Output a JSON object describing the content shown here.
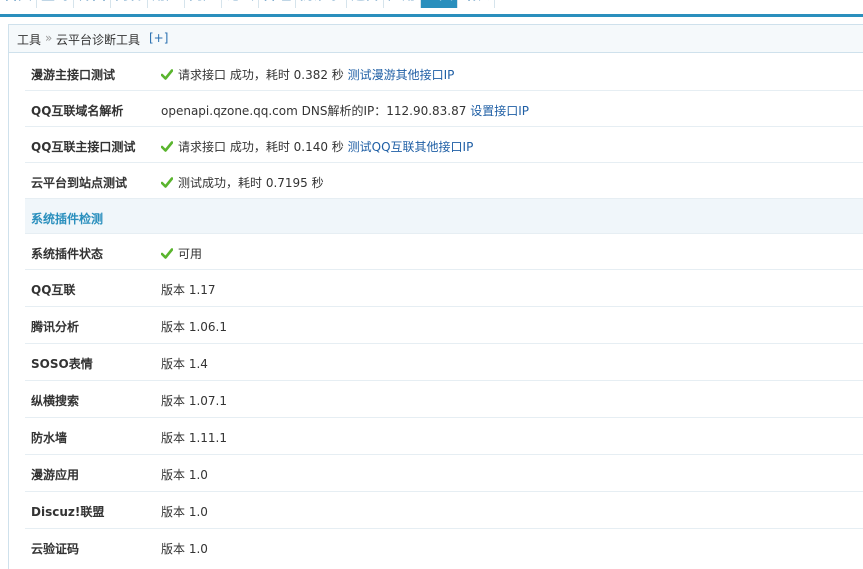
{
  "nav": {
    "items": [
      "首页",
      "全局",
      "界面",
      "内容",
      "用户",
      "门户",
      "论坛",
      "群组",
      "防灌水",
      "运营",
      "应用",
      "工具",
      "站长",
      "UCenter"
    ],
    "active_index": 11
  },
  "breadcrumb": {
    "root": "工具",
    "separator": "»",
    "current": "云平台诊断工具",
    "add": "[+]"
  },
  "diagnostics": [
    {
      "label": "漫游主接口测试",
      "status_icon": "check-icon",
      "text": "请求接口 成功，耗时 0.382 秒",
      "link": "测试漫游其他接口IP"
    },
    {
      "label": "QQ互联域名解析",
      "status_icon": "",
      "text": "openapi.qzone.qq.com DNS解析的IP：112.90.83.87",
      "link": "设置接口IP"
    },
    {
      "label": "QQ互联主接口测试",
      "status_icon": "check-icon",
      "text": "请求接口 成功，耗时 0.140 秒",
      "link": "测试QQ互联其他接口IP"
    },
    {
      "label": "云平台到站点测试",
      "status_icon": "check-icon",
      "text": "测试成功，耗时 0.7195 秒",
      "link": ""
    }
  ],
  "plugin_section_title": "系统插件检测",
  "plugin_status": {
    "label": "系统插件状态",
    "status_icon": "check-icon",
    "text": "可用"
  },
  "plugins": [
    {
      "label": "QQ互联",
      "version": "版本 1.17"
    },
    {
      "label": "腾讯分析",
      "version": "版本 1.06.1"
    },
    {
      "label": "SOSO表情",
      "version": "版本 1.4"
    },
    {
      "label": "纵横搜索",
      "version": "版本 1.07.1"
    },
    {
      "label": "防水墙",
      "version": "版本 1.11.1"
    },
    {
      "label": "漫游应用",
      "version": "版本 1.0"
    },
    {
      "label": "Discuz!联盟",
      "version": "版本 1.0"
    },
    {
      "label": "云验证码",
      "version": "版本 1.0"
    }
  ],
  "colors": {
    "accent": "#2a8fbd",
    "link": "#1f5fa5",
    "check": "#5ab52e"
  }
}
